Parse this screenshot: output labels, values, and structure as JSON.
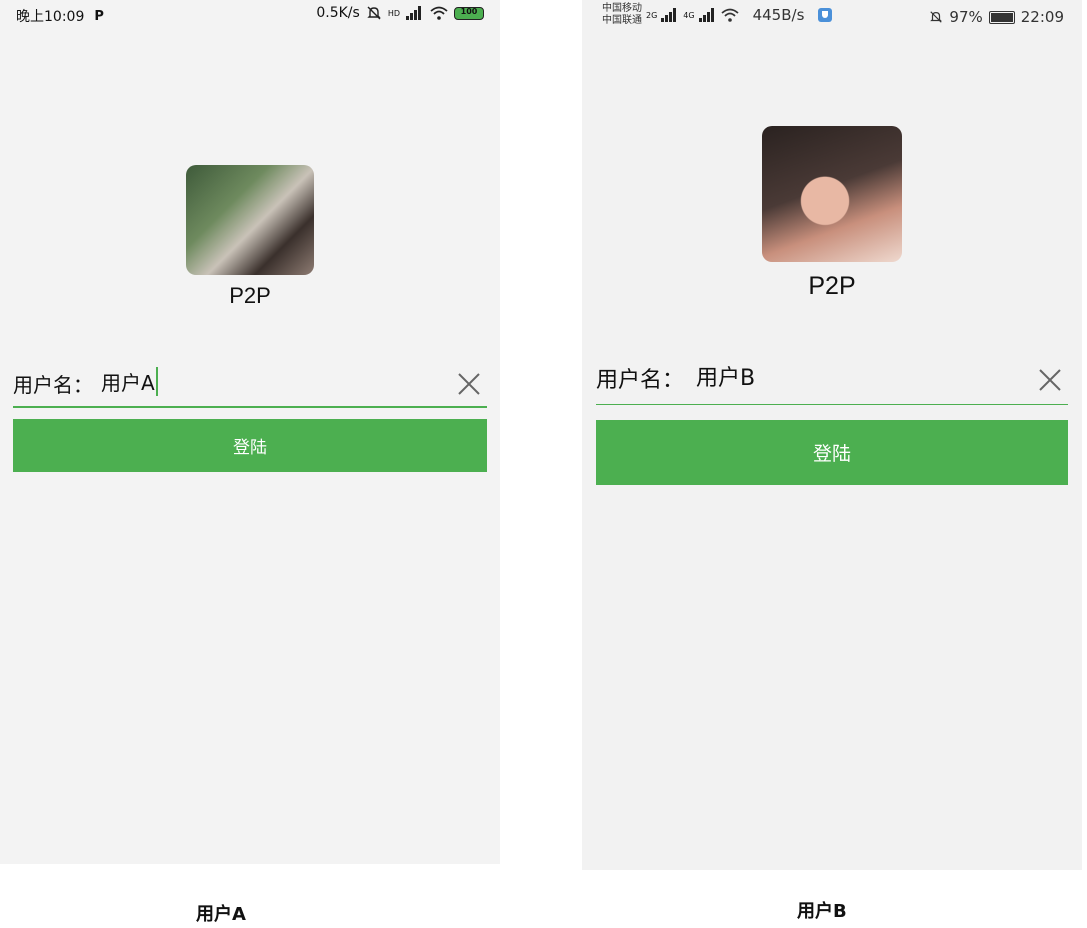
{
  "phoneA": {
    "status": {
      "time": "晚上10:09",
      "p_icon": "P",
      "net_rate": "0.5K/s",
      "signal_tag": "HD",
      "battery": "100"
    },
    "app_name": "P2P",
    "field_label": "用户名：",
    "field_value": "用户A",
    "login_label": "登陆",
    "caption": "用户A"
  },
  "phoneB": {
    "status": {
      "carrier1": "中国移动",
      "carrier2": "中国联通",
      "sig1": "2G",
      "sig2": "4G",
      "net_rate": "445B/s",
      "battery_pct": "97%",
      "time": "22:09"
    },
    "app_name": "P2P",
    "field_label": "用户名：",
    "field_value": "用户B",
    "login_label": "登陆",
    "caption": "用户B"
  },
  "colors": {
    "accent": "#4caf50",
    "background": "#f3f3f3"
  }
}
